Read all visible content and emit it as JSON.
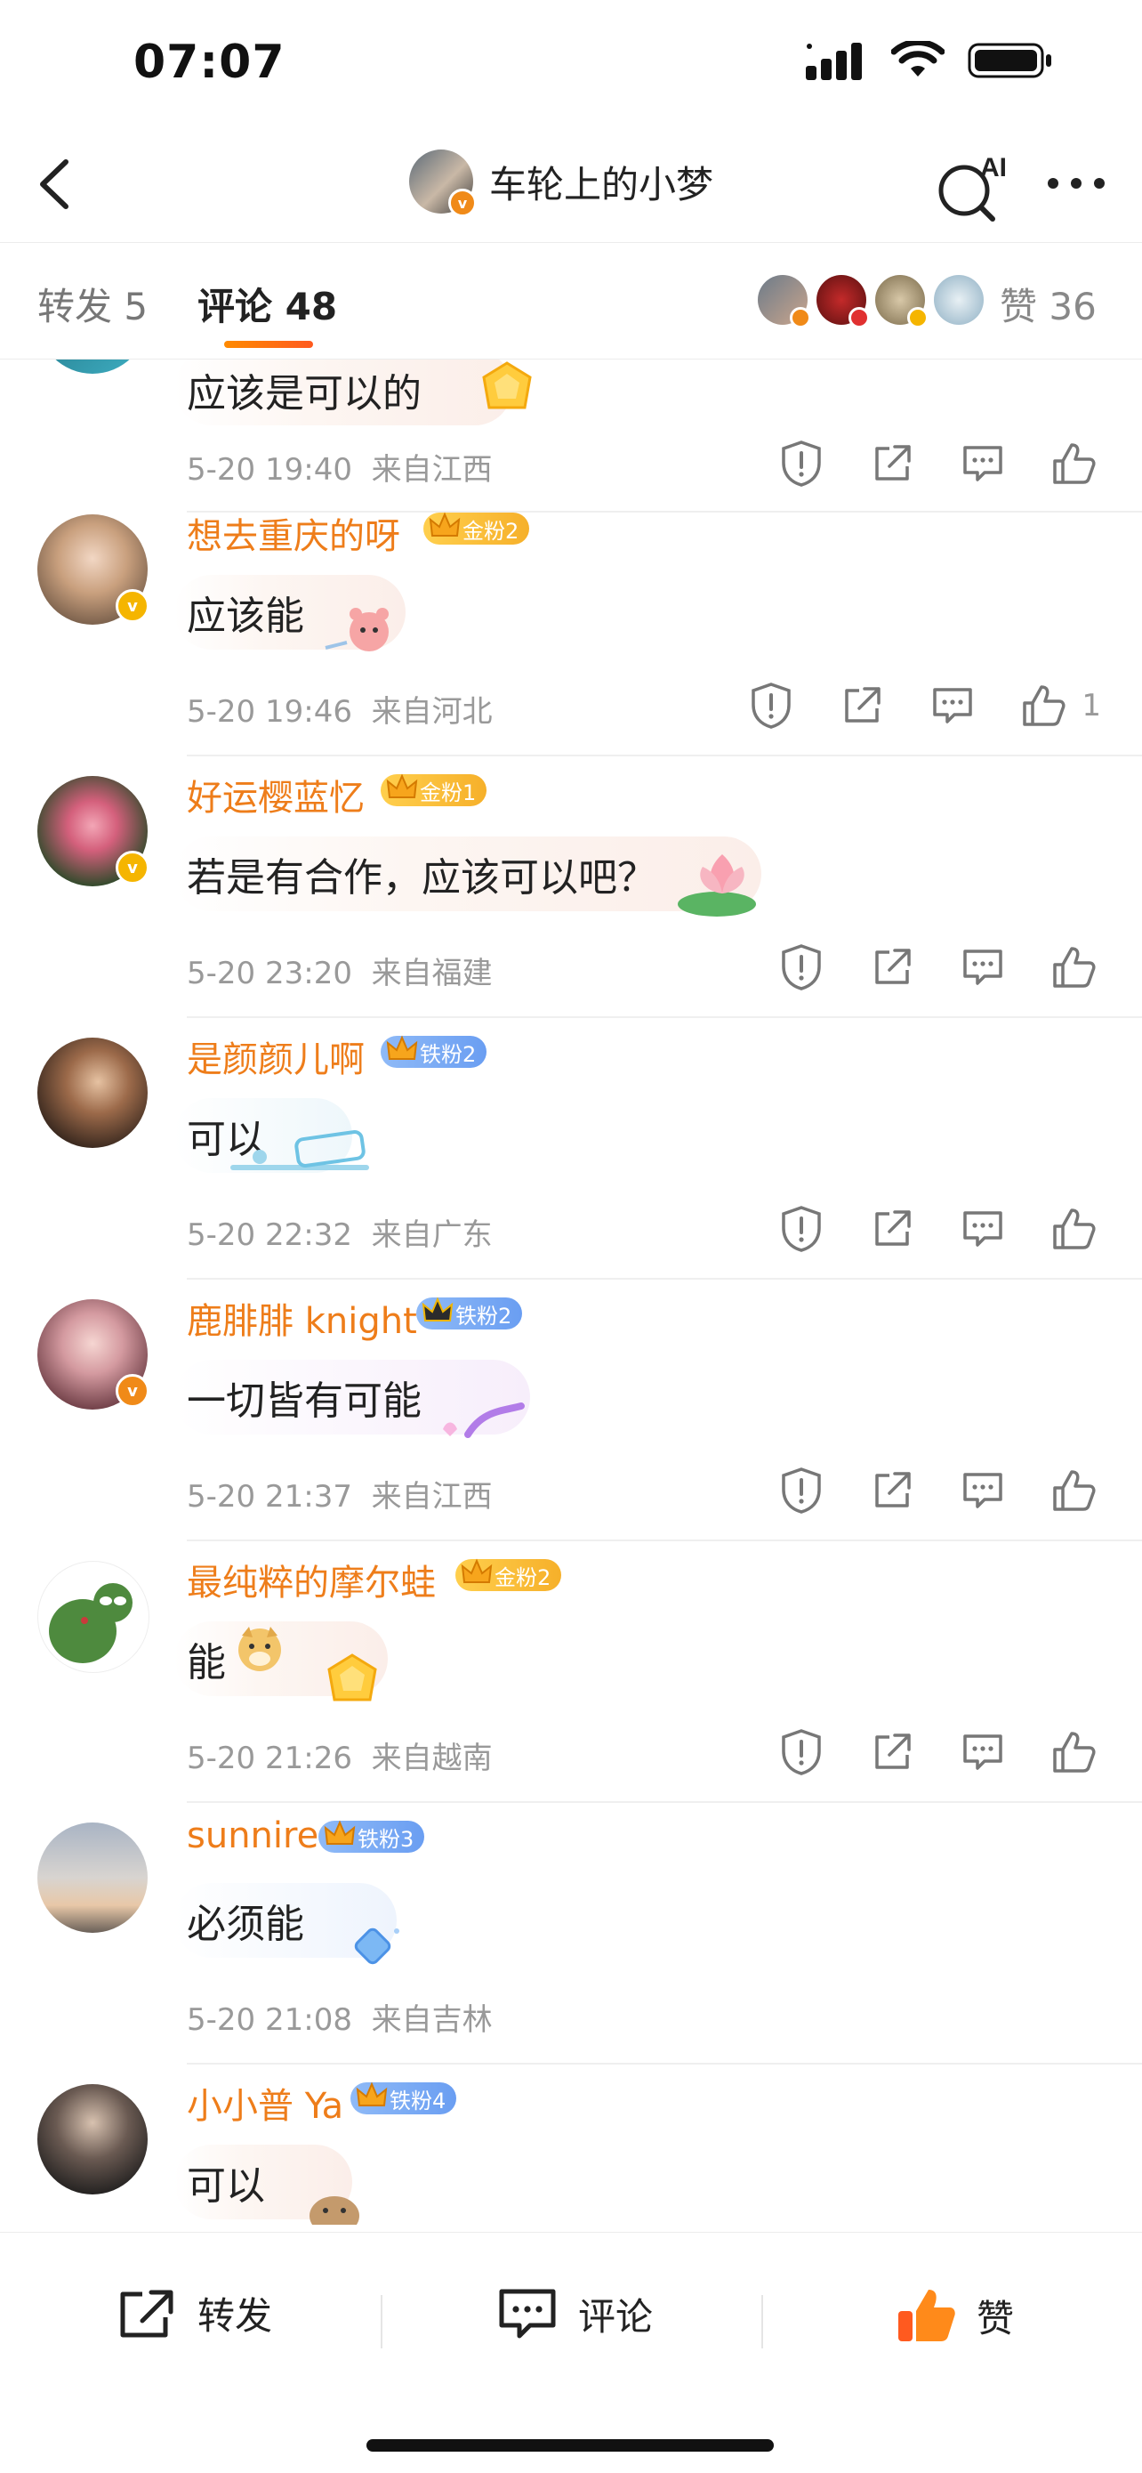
{
  "status": {
    "time": "07:07"
  },
  "nav": {
    "title": "车轮上的小梦",
    "ai_label": "AI"
  },
  "tabs": {
    "repost": "转发 5",
    "comments": "评论 48",
    "likes": "赞 36"
  },
  "comments": [
    {
      "user": "",
      "text": "应该是可以的",
      "time": "5-20 19:40",
      "location": "来自江西",
      "likes": ""
    },
    {
      "user": "想去重庆的呀",
      "badge": "金粉2",
      "text": "应该能",
      "time": "5-20 19:46",
      "location": "来自河北",
      "likes": "1"
    },
    {
      "user": "好运樱蓝忆",
      "badge": "金粉1",
      "text": "若是有合作，应该可以吧？",
      "time": "5-20 23:20",
      "location": "来自福建",
      "likes": ""
    },
    {
      "user": "是颜颜儿啊",
      "badge": "铁粉2",
      "text": "可以",
      "time": "5-20 22:32",
      "location": "来自广东",
      "likes": ""
    },
    {
      "user": "鹿腓腓 knight",
      "badge": "铁粉2",
      "text": "一切皆有可能",
      "time": "5-20 21:37",
      "location": "来自江西",
      "likes": ""
    },
    {
      "user": "最纯粹的摩尔蛙",
      "badge": "金粉2",
      "text": "能",
      "time": "5-20 21:26",
      "location": "来自越南",
      "likes": ""
    },
    {
      "user": "sunnire",
      "badge": "铁粉3",
      "text": "必须能",
      "time": "5-20 21:08",
      "location": "来自吉林",
      "likes": ""
    },
    {
      "user": "小小普 Ya",
      "badge": "铁粉4",
      "text": "可以",
      "time": "",
      "location": "",
      "likes": ""
    }
  ],
  "bottom": {
    "repost": "转发",
    "comment": "评论",
    "like": "赞"
  },
  "colors": {
    "accent": "#ee7d1a",
    "like_orange": "#ff6a1a",
    "gold_badge": "#f6b02a",
    "iron_badge": "#6a9ef2"
  }
}
